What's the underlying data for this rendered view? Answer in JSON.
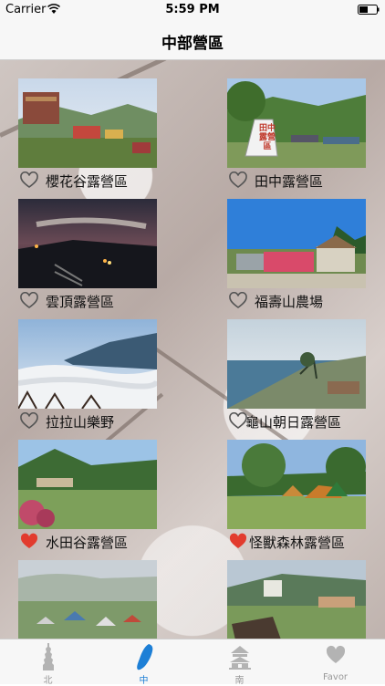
{
  "status_bar": {
    "carrier": "Carrier",
    "time": "5:59 PM"
  },
  "nav": {
    "title": "中部營區"
  },
  "campsites": [
    {
      "name": "櫻花谷露營區",
      "favorite": false
    },
    {
      "name": "田中露營區",
      "favorite": false
    },
    {
      "name": "雲頂露營區",
      "favorite": false
    },
    {
      "name": "福壽山農場",
      "favorite": false
    },
    {
      "name": "拉拉山樂野",
      "favorite": false
    },
    {
      "name": "龜山朝日露營區",
      "favorite": false
    },
    {
      "name": "水田谷露營區",
      "favorite": true
    },
    {
      "name": "怪獸森林露營區",
      "favorite": true
    },
    {
      "name": "",
      "favorite": false
    },
    {
      "name": "",
      "favorite": false
    }
  ],
  "sign_text": "田中露營區",
  "tabs": [
    {
      "label": "北",
      "icon": "taipei-101-icon",
      "active": false
    },
    {
      "label": "中",
      "icon": "taiwan-map-icon",
      "active": true
    },
    {
      "label": "南",
      "icon": "memorial-hall-icon",
      "active": false
    },
    {
      "label": "Favor",
      "icon": "heart-icon",
      "active": false
    }
  ],
  "colors": {
    "accent": "#1d7fd6",
    "favorite": "#e23b2e",
    "inactive": "#999999"
  }
}
